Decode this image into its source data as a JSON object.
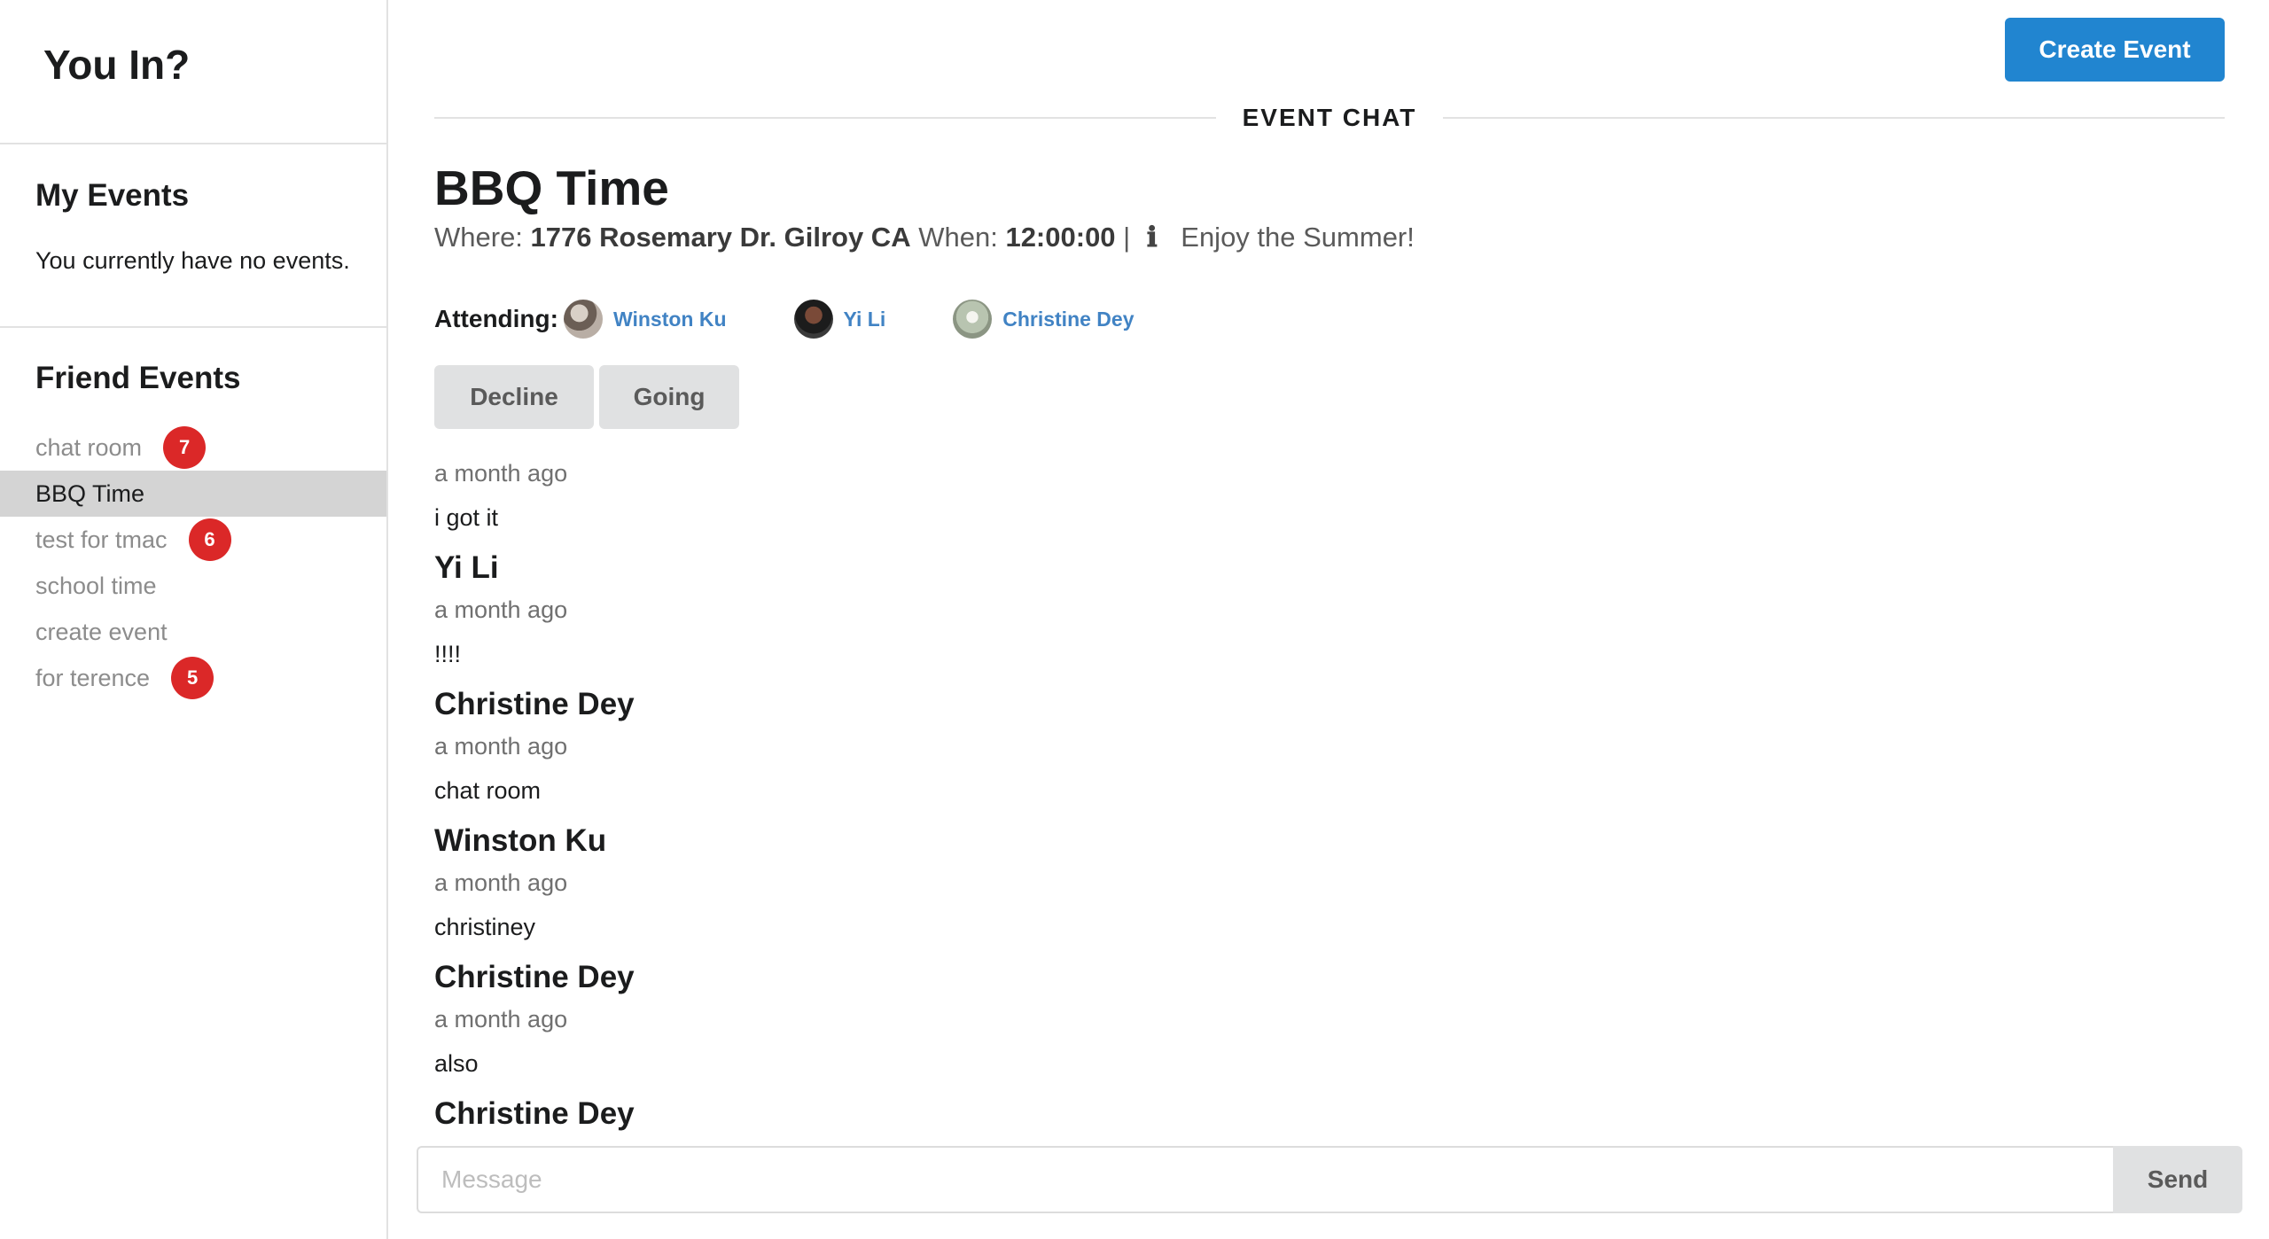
{
  "app": {
    "title": "You In?"
  },
  "sidebar": {
    "my_events": {
      "title": "My Events",
      "empty_text": "You currently have no events."
    },
    "friend_events": {
      "title": "Friend Events",
      "items": [
        {
          "label": "chat room",
          "badge": "7",
          "active": false
        },
        {
          "label": "BBQ Time",
          "badge": "",
          "active": true
        },
        {
          "label": "test for tmac",
          "badge": "6",
          "active": false
        },
        {
          "label": "school time",
          "badge": "",
          "active": false
        },
        {
          "label": "create event",
          "badge": "",
          "active": false
        },
        {
          "label": "for terence",
          "badge": "5",
          "active": false
        }
      ]
    }
  },
  "header": {
    "create_button": "Create Event",
    "section_label": "EVENT CHAT"
  },
  "event": {
    "title": "BBQ Time",
    "where_label": "Where:",
    "where_value": "1776 Rosemary Dr. Gilroy CA",
    "when_label": "When:",
    "when_value": "12:00:00",
    "separator": "|",
    "info_icon": "info-icon",
    "description": "Enjoy the Summer!",
    "attending_label": "Attending:",
    "attendees": [
      {
        "name": "Winston Ku"
      },
      {
        "name": "Yi Li"
      },
      {
        "name": "Christine Dey"
      }
    ],
    "decline_button": "Decline",
    "going_button": "Going"
  },
  "chat": {
    "messages": [
      {
        "author": "",
        "time": "a month ago",
        "text": "i got it"
      },
      {
        "author": "Yi Li",
        "time": "a month ago",
        "text": "!!!!"
      },
      {
        "author": "Christine Dey",
        "time": "a month ago",
        "text": "chat room"
      },
      {
        "author": "Winston Ku",
        "time": "a month ago",
        "text": "christiney"
      },
      {
        "author": "Christine Dey",
        "time": "a month ago",
        "text": "also"
      },
      {
        "author": "Christine Dey",
        "time": "",
        "text": ""
      }
    ]
  },
  "composer": {
    "placeholder": "Message",
    "value": "",
    "send_button": "Send"
  },
  "colors": {
    "primary": "#2185d0",
    "badge": "#db2828",
    "link": "#4183c4",
    "active_item": "#d4d4d4"
  }
}
